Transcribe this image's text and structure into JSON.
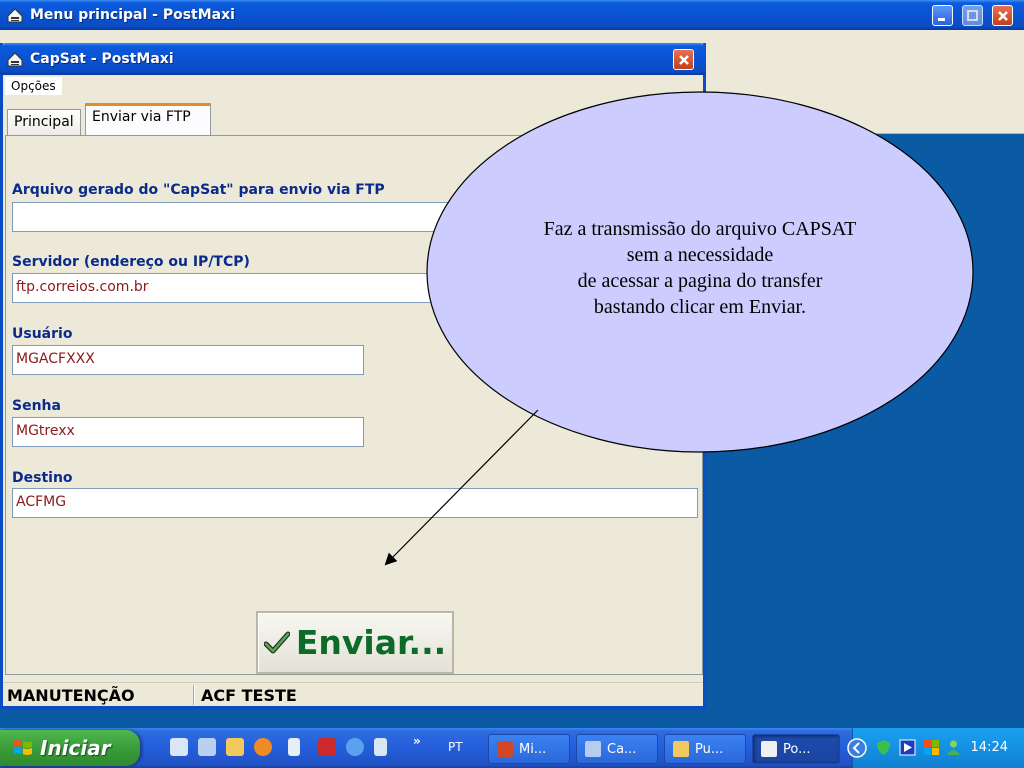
{
  "main_window": {
    "title": "Menu principal - PostMaxi"
  },
  "dialog": {
    "title": "CapSat - PostMaxi",
    "menu": [
      "Opções"
    ],
    "tabs": [
      {
        "label": "Principal",
        "active": false
      },
      {
        "label": "Enviar via FTP",
        "active": true
      }
    ],
    "fields": [
      {
        "label": "Arquivo gerado do \"CapSat\" para envio via FTP",
        "value": ""
      },
      {
        "label": "Servidor (endereço ou IP/TCP)",
        "value": "ftp.correios.com.br"
      },
      {
        "label": "Usuário",
        "value": "MGACFXXX"
      },
      {
        "label": "Senha",
        "value": "MGtrexx"
      },
      {
        "label": "Destino",
        "value": "ACFMG"
      }
    ],
    "send_button": "Enviar...",
    "status": [
      "MANUTENÇÃO",
      "ACF TESTE"
    ]
  },
  "callout": {
    "lines": [
      "Faz a transmissão do arquivo CAPSAT",
      "sem a necessidade",
      "de acessar a pagina do transfer",
      "bastando clicar em Enviar."
    ],
    "fill_color": "#ccccff"
  },
  "taskbar": {
    "start_label": "Iniciar",
    "language": "PT",
    "tasks": [
      {
        "label": "Mi...",
        "icon": "powerpoint-icon",
        "active": false
      },
      {
        "label": "Ca...",
        "icon": "app-icon",
        "active": false
      },
      {
        "label": "Pu...",
        "icon": "folder-icon",
        "active": false
      },
      {
        "label": "Po...",
        "icon": "postmaxi-icon",
        "active": true
      }
    ],
    "clock": "14:24"
  },
  "colors": {
    "xp_blue": "#0a4cc4",
    "label_blue": "#0a2a8c",
    "input_text": "#8b1a1a",
    "send_green": "#0d6b2a"
  }
}
